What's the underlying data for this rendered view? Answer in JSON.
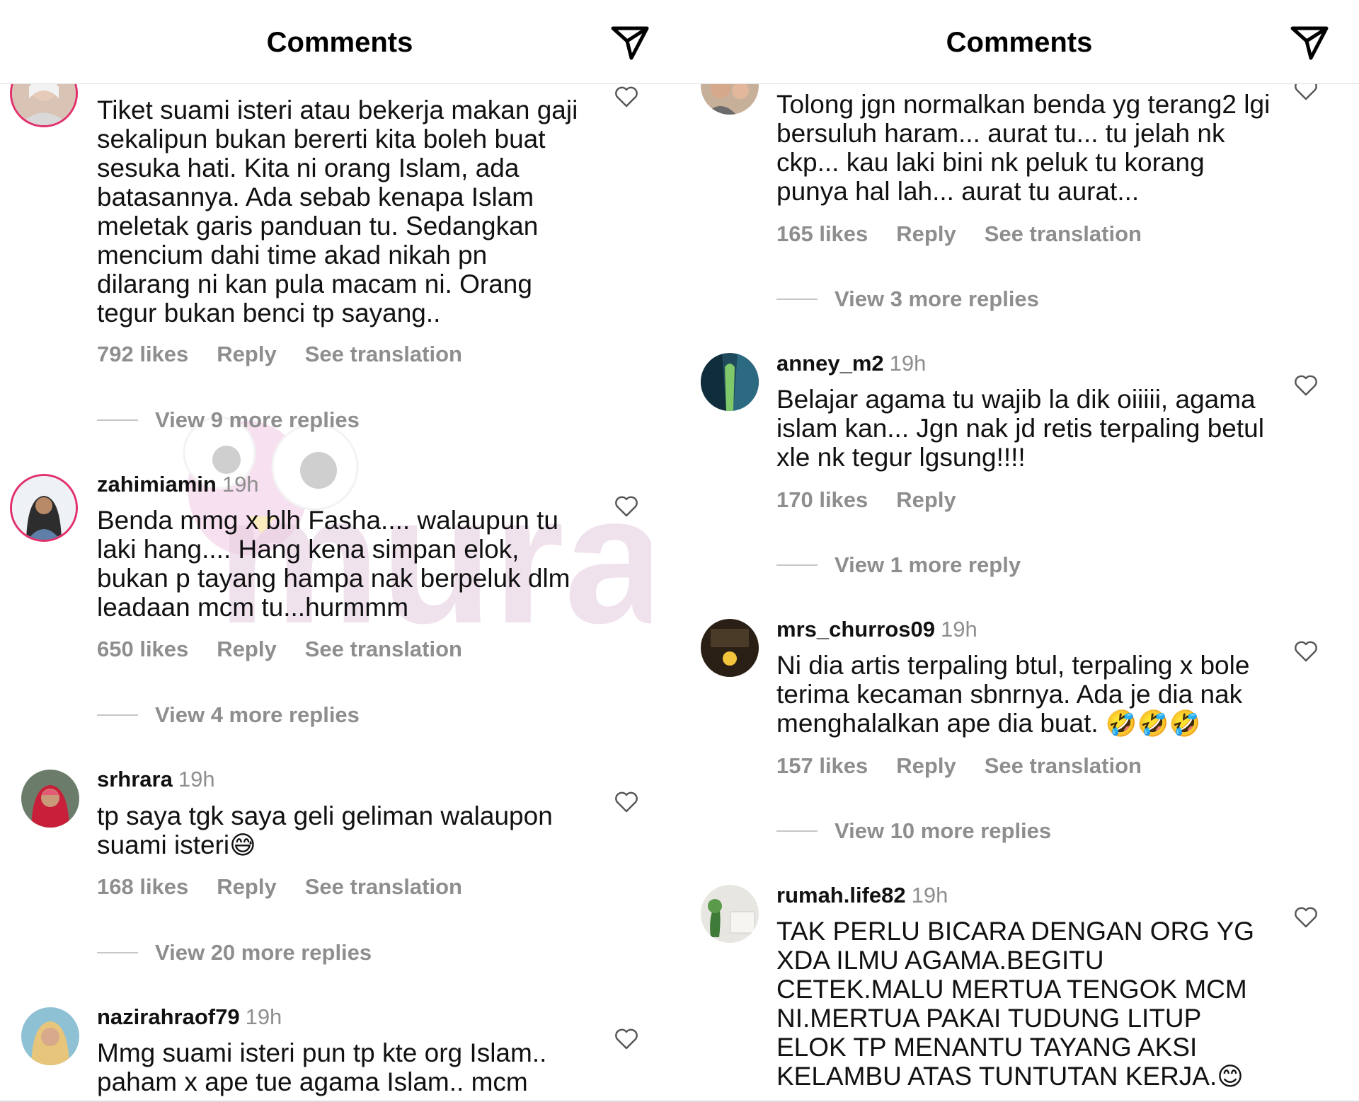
{
  "left": {
    "title": "Comments",
    "comments": [
      {
        "username": "",
        "time": "",
        "text": "Tiket suami isteri atau bekerja makan gaji sekalipun bukan bererti kita boleh buat sesuka hati. Kita ni orang Islam, ada batasannya. Ada sebab kenapa Islam meletak garis panduan tu. Sedangkan mencium dahi time akad nikah pn dilarang ni kan pula macam ni. Orang tegur bukan benci tp sayang..",
        "likes": "792 likes",
        "reply": "Reply",
        "translate": "See translation",
        "view_replies": "View 9 more replies"
      },
      {
        "username": "zahimiamin",
        "time": "19h",
        "text": "Benda mmg x blh Fasha.... walaupun tu laki hang.... Hang kena simpan elok, bukan p tayang hampa nak berpeluk dlm leadaan mcm tu...hurmmm",
        "likes": "650 likes",
        "reply": "Reply",
        "translate": "See translation",
        "view_replies": "View 4 more replies"
      },
      {
        "username": "srhrara",
        "time": "19h",
        "text": "tp saya tgk saya geli geliman walaupon suami isteri",
        "emoji": "😅",
        "likes": "168 likes",
        "reply": "Reply",
        "translate": "See translation",
        "view_replies": "View 20 more replies"
      },
      {
        "username": "nazirahraof79",
        "time": "19h",
        "text": "Mmg suami isteri pun tp kte org Islam.. paham x ape tue agama Islam.. mcm"
      }
    ]
  },
  "right": {
    "title": "Comments",
    "comments": [
      {
        "username": "",
        "time": "",
        "text": "Tolong jgn normalkan benda yg terang2 lgi bersuluh haram... aurat tu... tu jelah nk ckp... kau laki bini nk peluk tu korang punya hal lah... aurat tu aurat...",
        "likes": "165 likes",
        "reply": "Reply",
        "translate": "See translation",
        "view_replies": "View 3 more replies"
      },
      {
        "username": "anney_m2",
        "time": "19h",
        "text": "Belajar agama tu wajib la dik oiiiii, agama islam kan... Jgn nak jd retis terpaling betul xle nk tegur lgsung!!!!",
        "likes": "170 likes",
        "reply": "Reply",
        "view_replies": "View 1 more reply"
      },
      {
        "username": "mrs_churros09",
        "time": "19h",
        "text": "Ni dia artis terpaling btul, terpaling x bole terima kecaman sbnrnya. Ada je dia nak menghalalkan ape dia buat.",
        "emoji": "🤣🤣🤣",
        "likes": "157 likes",
        "reply": "Reply",
        "translate": "See translation",
        "view_replies": "View 10 more replies"
      },
      {
        "username": "rumah.life82",
        "time": "19h",
        "text": "TAK PERLU BICARA DENGAN ORG YG XDA ILMU AGAMA.BEGITU CETEK.MALU MERTUA TENGOK MCM NI.MERTUA PAKAI TUDUNG LITUP ELOK TP MENANTU TAYANG AKSI KELAMBU ATAS TUNTUTAN KERJA.",
        "emoji": "😊"
      }
    ]
  },
  "watermark": {
    "text": "murai"
  }
}
